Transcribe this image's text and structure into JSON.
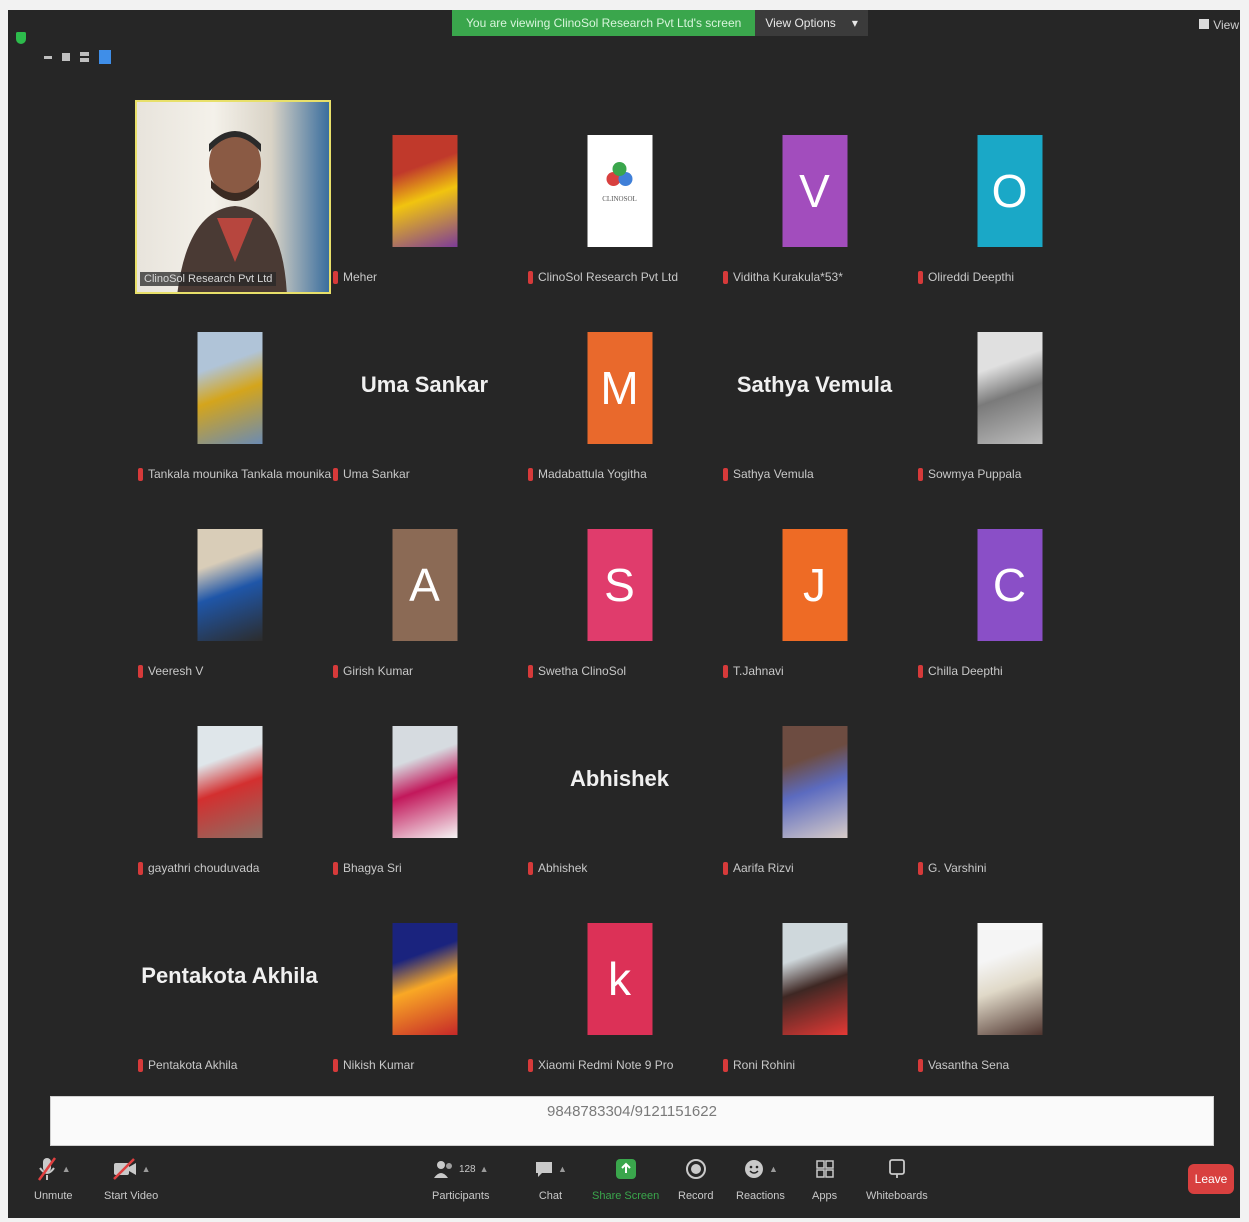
{
  "banner": {
    "viewing_text": "You are viewing ClinoSol Research Pvt Ltd's screen",
    "view_options": "View Options",
    "view_corner": "View"
  },
  "grid": {
    "rows": [
      [
        {
          "type": "video",
          "name": "ClinoSol Research Pvt Ltd"
        },
        {
          "type": "photo",
          "name": "Meher",
          "colors": [
            "#c0392b",
            "#f1c40f",
            "#7d3c98"
          ]
        },
        {
          "type": "logo",
          "name": "ClinoSol Research Pvt Ltd",
          "logo_text": "CLINOSOL"
        },
        {
          "type": "letter",
          "name": "Viditha Kurakula*53*",
          "letter": "V",
          "color": "#a24dbd"
        },
        {
          "type": "letter",
          "name": "Olireddi Deepthi",
          "letter": "O",
          "color": "#1aa8c7"
        }
      ],
      [
        {
          "type": "photo",
          "name": "Tankala mounika Tankala mounika",
          "colors": [
            "#b0c4d8",
            "#d4a51c",
            "#6b8bb3"
          ]
        },
        {
          "type": "text",
          "name": "Uma Sankar",
          "display": "Uma Sankar"
        },
        {
          "type": "letter",
          "name": "Madabattula Yogitha",
          "letter": "M",
          "color": "#e9692c"
        },
        {
          "type": "text",
          "name": "Sathya Vemula",
          "display": "Sathya Vemula"
        },
        {
          "type": "photo",
          "name": "Sowmya Puppala",
          "colors": [
            "#e0e0e0",
            "#7a7a7a",
            "#bdbdbd"
          ]
        }
      ],
      [
        {
          "type": "photo",
          "name": "Veeresh V",
          "colors": [
            "#d9cdb8",
            "#1f56a8",
            "#2c2c2c"
          ]
        },
        {
          "type": "letter",
          "name": "Girish Kumar",
          "letter": "A",
          "color": "#8b6a55"
        },
        {
          "type": "letter",
          "name": "Swetha ClinoSol",
          "letter": "S",
          "color": "#e03c6c"
        },
        {
          "type": "letter",
          "name": "T.Jahnavi",
          "letter": "J",
          "color": "#ee6b25"
        },
        {
          "type": "letter",
          "name": "Chilla Deepthi",
          "letter": "C",
          "color": "#8a4fc7"
        }
      ],
      [
        {
          "type": "photo",
          "name": "gayathri chouduvada",
          "colors": [
            "#dfe6ea",
            "#d32f2f",
            "#8d6e63"
          ]
        },
        {
          "type": "photo",
          "name": "Bhagya Sri",
          "colors": [
            "#d6dbe0",
            "#c2185b",
            "#f5f5f5"
          ]
        },
        {
          "type": "text",
          "name": "Abhishek",
          "display": "Abhishek"
        },
        {
          "type": "photo",
          "name": "Aarifa Rizvi",
          "colors": [
            "#6d4c41",
            "#5c6bc0",
            "#d7ccc8"
          ]
        },
        {
          "type": "empty",
          "name": "G. Varshini"
        }
      ],
      [
        {
          "type": "text",
          "name": "Pentakota Akhila",
          "display": "Pentakota Akhila"
        },
        {
          "type": "photo",
          "name": "Nikish Kumar",
          "colors": [
            "#1a237e",
            "#f9a825",
            "#c62828"
          ]
        },
        {
          "type": "letter",
          "name": "Xiaomi Redmi Note 9 Pro",
          "letter": "k",
          "color": "#dc3157"
        },
        {
          "type": "photo",
          "name": "Roni Rohini",
          "colors": [
            "#cfd8dc",
            "#3e2723",
            "#e53935"
          ]
        },
        {
          "type": "photo",
          "name": "Vasantha Sena",
          "colors": [
            "#f5f5f5",
            "#e0d9c8",
            "#4e342e"
          ]
        }
      ]
    ]
  },
  "phone_strip": {
    "text": "9848783304/9121151622"
  },
  "toolbar": {
    "unmute": "Unmute",
    "start_video": "Start Video",
    "participants": "Participants",
    "participants_count": "128",
    "chat": "Chat",
    "share_screen": "Share Screen",
    "record": "Record",
    "reactions": "Reactions",
    "apps": "Apps",
    "whiteboards": "Whiteboards",
    "leave": "Leave"
  },
  "colors": {
    "background": "#262626",
    "banner_green": "#3aa64c",
    "leave_red": "#d8403f",
    "muted_mic_red": "#d63a3a",
    "active_speaker_border": "#e8e06a"
  }
}
